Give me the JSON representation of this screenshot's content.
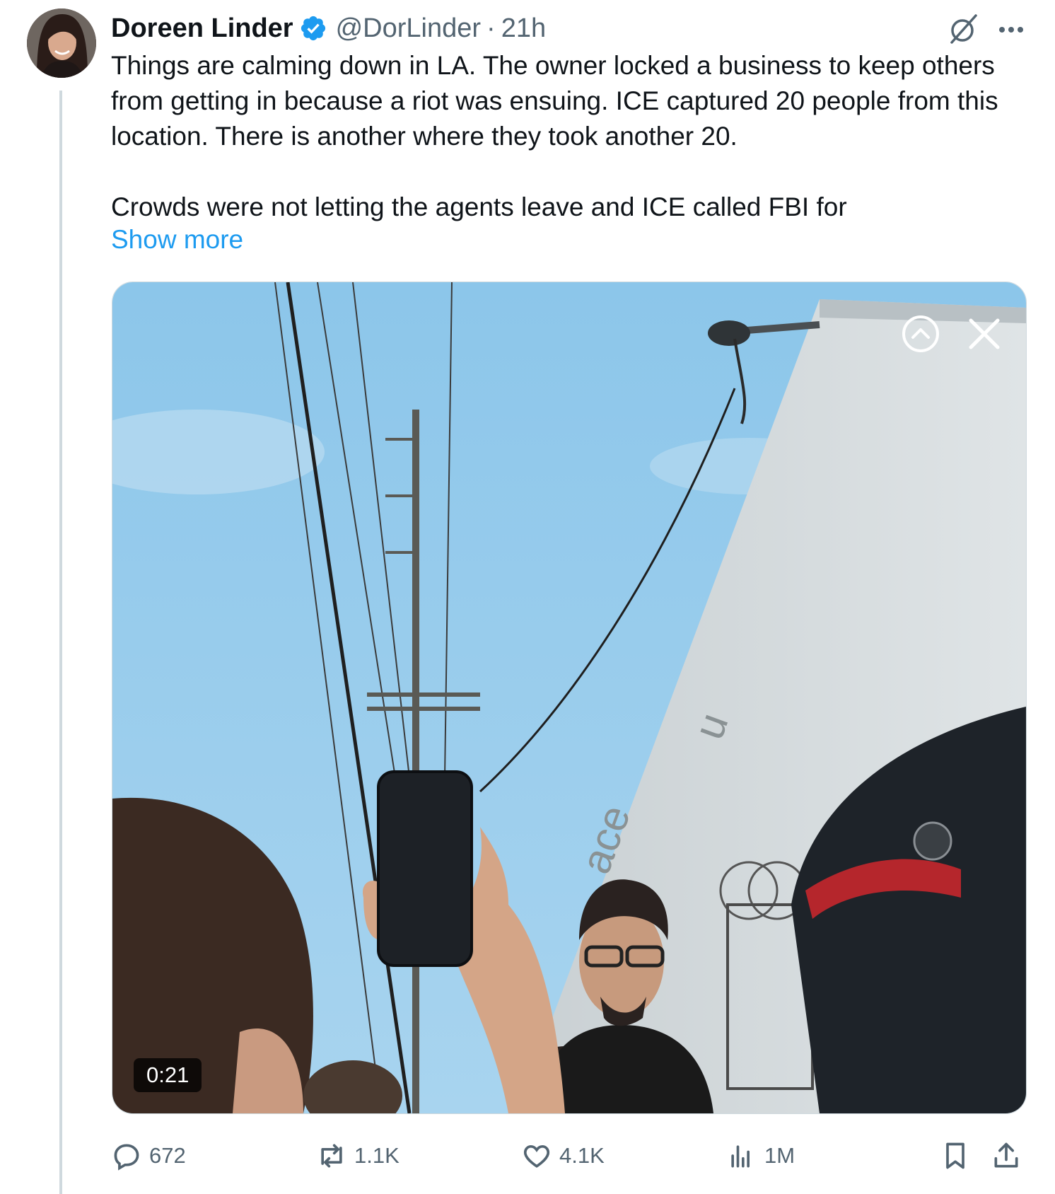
{
  "author": {
    "name": "Doreen Linder",
    "handle": "@DorLinder",
    "separator": "·",
    "time": "21h"
  },
  "tweet": {
    "paragraph1": "Things are calming down in LA.  The owner locked a business to keep others from getting in because a riot was ensuing. ICE captured 20 people from this location.  There is another where they took another 20.",
    "paragraph2": "Crowds were not letting the agents leave and ICE called FBI for",
    "show_more": "Show more"
  },
  "media": {
    "duration": "0:21"
  },
  "actions": {
    "replies": "672",
    "reposts": "1.1K",
    "likes": "4.1K",
    "views": "1M"
  },
  "colors": {
    "link": "#1d9bf0",
    "muted": "#536471",
    "verified": "#1d9bf0"
  },
  "icons": [
    "verified-badge-icon",
    "grok-icon",
    "more-icon",
    "collapse-icon",
    "close-icon",
    "reply-icon",
    "repost-icon",
    "like-icon",
    "views-icon",
    "bookmark-icon",
    "share-icon"
  ]
}
